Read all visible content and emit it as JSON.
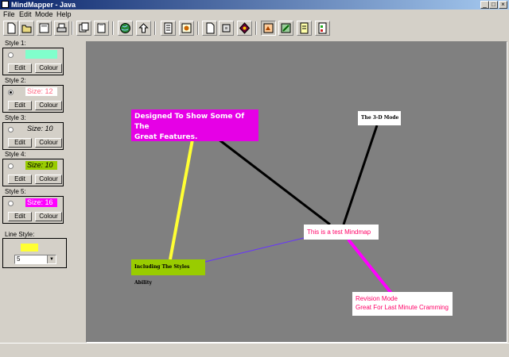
{
  "window": {
    "title": "MindMapper - Java"
  },
  "menu": [
    "File",
    "Edit",
    "Mode",
    "Help"
  ],
  "toolbar_icons": [
    "new-document-icon",
    "open-file-icon",
    "save-icon",
    "print-icon",
    "copy-icon",
    "paste-icon",
    "globe-icon",
    "export-icon",
    "notes-icon",
    "image-icon",
    "blank-page-icon",
    "frame-icon",
    "palette-icon",
    "mode-1-icon",
    "mode-2-icon",
    "revision-notes-icon",
    "checklist-icon"
  ],
  "styles": [
    {
      "label": "Style 1:",
      "sample": "",
      "bg": "#80ffcc",
      "color": "#ffffff",
      "selected": false
    },
    {
      "label": "Style 2:",
      "sample": "Size: 12",
      "bg": "#ffffff",
      "color": "#ff6680",
      "selected": true
    },
    {
      "label": "Style 3:",
      "sample": "Size: 10",
      "bg": "#d4d0c8",
      "color": "#000000",
      "selected": false
    },
    {
      "label": "Style 4:",
      "sample": "Size: 10",
      "bg": "#99cc00",
      "color": "#000000",
      "selected": false
    },
    {
      "label": "Style 5:",
      "sample": "Size: 16",
      "bg": "#ff00ff",
      "color": "#ffffff",
      "selected": false
    }
  ],
  "buttons": {
    "edit": "Edit",
    "colour": "Colour"
  },
  "line_style": {
    "label": "Line Style:",
    "value": "5",
    "color": "#ffff33"
  },
  "nodes": [
    {
      "id": "features",
      "text": "Designed To Show Some Of The\nGreat Features.",
      "bg": "#e600e6",
      "color": "#ffffff"
    },
    {
      "id": "3d",
      "text": "The 3-D Mode",
      "bg": "#ffffff",
      "color": "#000000"
    },
    {
      "id": "center",
      "text": "This is a test Mindmap",
      "bg": "#ffffff",
      "color": "#ff0066"
    },
    {
      "id": "styles",
      "text": "Including The Styles Ability",
      "bg": "#99cc00",
      "color": "#000000"
    },
    {
      "id": "revision",
      "text": "Revision Mode\nGreat For Last Minute Cramming",
      "bg": "#ffffff",
      "color": "#ff0066"
    }
  ],
  "links": [
    {
      "from": "center",
      "to": "features",
      "color": "#000000"
    },
    {
      "from": "center",
      "to": "3d",
      "color": "#000000"
    },
    {
      "from": "center",
      "to": "styles",
      "color": "#6633ff"
    },
    {
      "from": "center",
      "to": "revision",
      "color": "#ff00ff"
    },
    {
      "from": "features",
      "to": "styles",
      "color": "#ffff33"
    }
  ]
}
